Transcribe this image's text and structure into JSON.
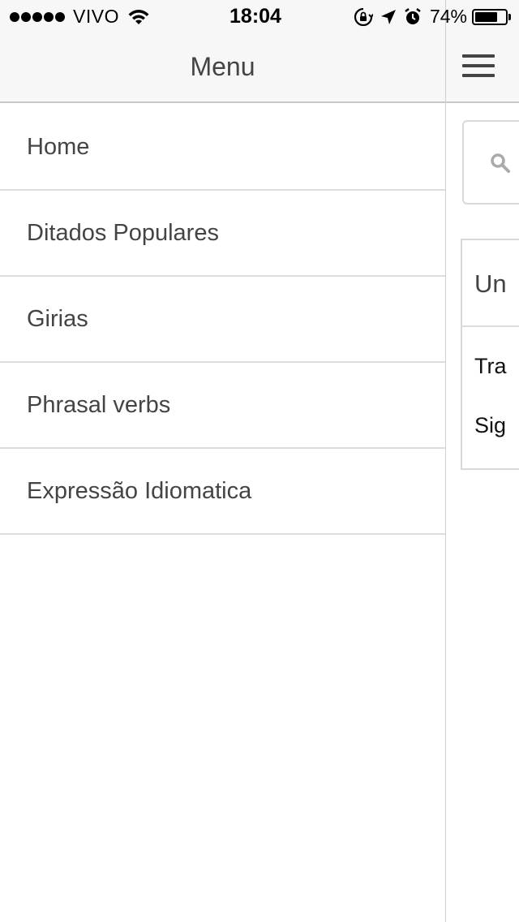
{
  "status_bar": {
    "carrier": "VIVO",
    "time": "18:04",
    "battery_percent": "74%",
    "battery_level": 0.74,
    "icons": [
      "signal-dots-icon",
      "wifi-icon",
      "orientation-lock-icon",
      "location-arrow-icon",
      "alarm-icon",
      "battery-icon"
    ]
  },
  "menu": {
    "title": "Menu",
    "items": [
      {
        "label": "Home"
      },
      {
        "label": "Ditados Populares"
      },
      {
        "label": "Girias"
      },
      {
        "label": "Phrasal verbs"
      },
      {
        "label": "Expressão Idiomatica"
      }
    ]
  },
  "content": {
    "hamburger_icon": "hamburger-menu-icon",
    "search_icon": "search-icon",
    "card": {
      "title": "Un",
      "line1": "Tra",
      "line2": "Sig"
    }
  },
  "colors": {
    "header_bg": "#f7f7f7",
    "text": "#444444",
    "divider": "#dcdcdc"
  }
}
